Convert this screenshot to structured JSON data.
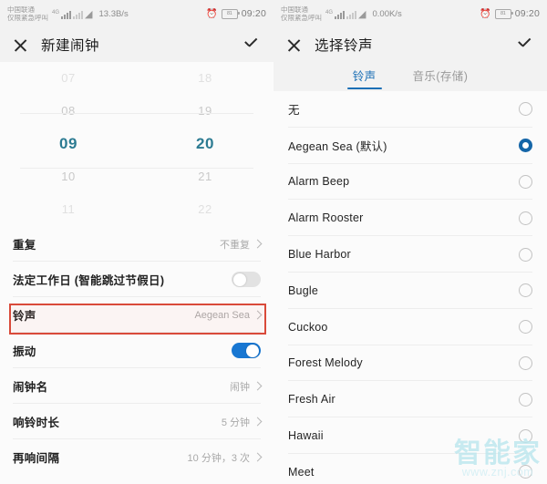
{
  "left": {
    "status": {
      "carrier_line1": "中国联通",
      "carrier_line2": "仅限紧急呼叫",
      "network_type": "4G",
      "net_speed": "13.3B/s",
      "battery_level": "81",
      "time": "09:20",
      "alarm_icon": "alarm-clock-icon",
      "wifi_icon": "wifi-icon"
    },
    "appbar": {
      "close_icon": "close-icon",
      "title": "新建闹钟",
      "confirm_icon": "check-icon"
    },
    "picker": {
      "hours": [
        "07",
        "08",
        "09",
        "10",
        "11"
      ],
      "minutes": [
        "18",
        "19",
        "20",
        "21",
        "22"
      ],
      "selected_hour": "09",
      "selected_minute": "20",
      "accent": "#2c7b92"
    },
    "settings": [
      {
        "label": "重复",
        "value": "不重复",
        "type": "chevron"
      },
      {
        "label": "法定工作日 (智能跳过节假日)",
        "value": "",
        "type": "toggle",
        "on": false
      },
      {
        "label": "铃声",
        "value": "Aegean Sea",
        "type": "chevron",
        "highlighted": true
      },
      {
        "label": "振动",
        "value": "",
        "type": "toggle",
        "on": true
      },
      {
        "label": "闹钟名",
        "value": "闹钟",
        "type": "chevron"
      },
      {
        "label": "响铃时长",
        "value": "5 分钟",
        "type": "chevron"
      },
      {
        "label": "再响间隔",
        "value": "10 分钟，3 次",
        "type": "chevron"
      }
    ],
    "highlight_color": "#d94a3a"
  },
  "right": {
    "status": {
      "carrier_line1": "中国联通",
      "carrier_line2": "仅限紧急呼叫",
      "network_type": "4G",
      "net_speed": "0.00K/s",
      "battery_level": "81",
      "time": "09:20",
      "alarm_icon": "alarm-clock-icon",
      "wifi_icon": "wifi-icon"
    },
    "appbar": {
      "close_icon": "close-icon",
      "title": "选择铃声",
      "confirm_icon": "check-icon"
    },
    "tabs": [
      {
        "label": "铃声",
        "active": true
      },
      {
        "label": "音乐(存储)",
        "active": false
      }
    ],
    "tab_accent": "#1b6fb5",
    "ringtones": [
      {
        "name": "无",
        "selected": false
      },
      {
        "name": "Aegean Sea (默认)",
        "selected": true
      },
      {
        "name": "Alarm Beep",
        "selected": false
      },
      {
        "name": "Alarm Rooster",
        "selected": false
      },
      {
        "name": "Blue Harbor",
        "selected": false
      },
      {
        "name": "Bugle",
        "selected": false
      },
      {
        "name": "Cuckoo",
        "selected": false
      },
      {
        "name": "Forest Melody",
        "selected": false
      },
      {
        "name": "Fresh Air",
        "selected": false
      },
      {
        "name": "Hawaii",
        "selected": false
      },
      {
        "name": "Meet",
        "selected": false
      }
    ],
    "watermark": {
      "text": "智能家",
      "url": "www.znj.com"
    }
  }
}
